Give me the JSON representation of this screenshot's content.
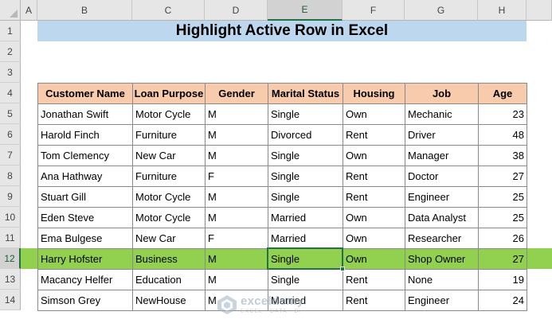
{
  "columns": [
    "A",
    "B",
    "C",
    "D",
    "E",
    "F",
    "G",
    "H"
  ],
  "rows": [
    "1",
    "2",
    "3",
    "4",
    "5",
    "6",
    "7",
    "8",
    "9",
    "10",
    "11",
    "12",
    "13",
    "14"
  ],
  "active_column": "E",
  "active_row": "12",
  "title": "Highlight Active Row in Excel",
  "table": {
    "headers": [
      "Customer Name",
      "Loan Purpose",
      "Gender",
      "Marital Status",
      "Housing",
      "Job",
      "Age"
    ],
    "records": [
      [
        "Jonathan Swift",
        "Motor Cycle",
        "M",
        "Single",
        "Own",
        "Mechanic",
        "23"
      ],
      [
        "Harold Finch",
        "Furniture",
        "M",
        "Divorced",
        "Rent",
        "Driver",
        "48"
      ],
      [
        "Tom Clemency",
        "New Car",
        "M",
        "Single",
        "Own",
        "Manager",
        "38"
      ],
      [
        "Ana Hathway",
        "Furniture",
        "F",
        "Single",
        "Rent",
        "Doctor",
        "27"
      ],
      [
        "Stuart Gill",
        "Motor Cycle",
        "M",
        "Single",
        "Rent",
        "Engineer",
        "25"
      ],
      [
        "Eden Steve",
        "Motor Cycle",
        "M",
        "Married",
        "Own",
        "Data Analyst",
        "25"
      ],
      [
        "Ema Bulgese",
        "New Car",
        "F",
        "Married",
        "Own",
        "Researcher",
        "26"
      ],
      [
        "Harry Hofster",
        "Business",
        "M",
        "Single",
        "Own",
        "Shop Owner",
        "27"
      ],
      [
        "Macancy Helfer",
        "Education",
        "M",
        "Single",
        "Rent",
        "None",
        "19"
      ],
      [
        "Simson Grey",
        "NewHouse",
        "M",
        "Married",
        "Rent",
        "Engineer",
        "24"
      ]
    ]
  },
  "colors": {
    "highlight_row": "#92d050",
    "header_fill": "#f8cbad",
    "title_fill": "#bdd7ee",
    "selection": "#217346"
  },
  "watermark": {
    "name": "exceldemy",
    "tagline": "EXCEL · DATA · BI"
  }
}
